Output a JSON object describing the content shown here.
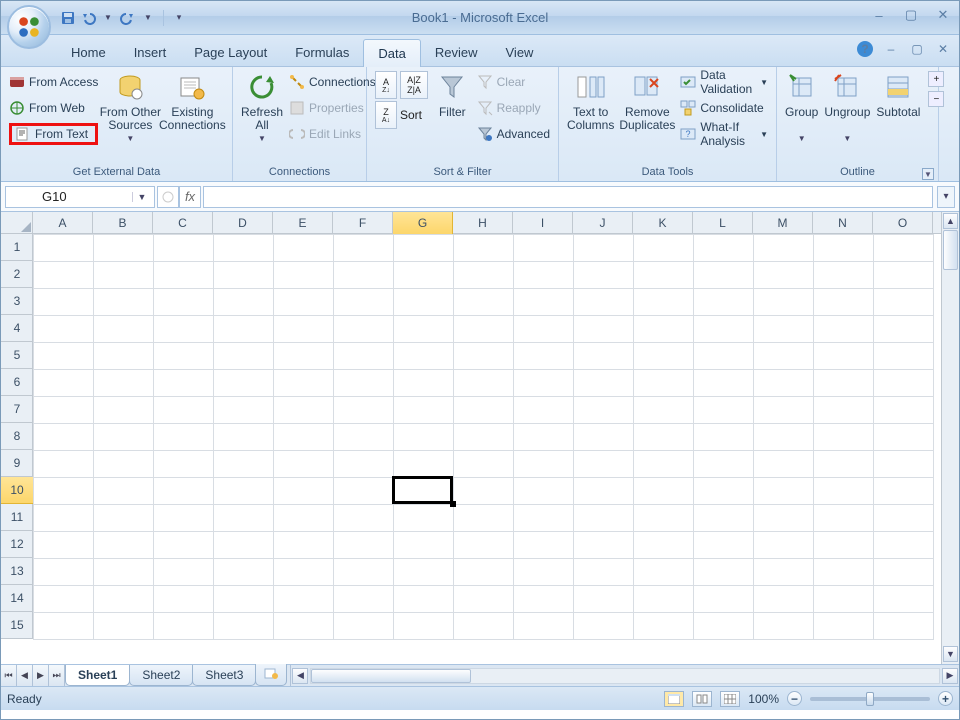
{
  "app_title": "Book1 - Microsoft Excel",
  "tabs": [
    "Home",
    "Insert",
    "Page Layout",
    "Formulas",
    "Data",
    "Review",
    "View"
  ],
  "active_tab": "Data",
  "ribbon_groups": {
    "get_external_data": {
      "label": "Get External Data",
      "from_access": "From Access",
      "from_web": "From Web",
      "from_text": "From Text",
      "from_other_sources": "From Other\nSources",
      "existing_connections": "Existing\nConnections"
    },
    "connections": {
      "label": "Connections",
      "refresh_all": "Refresh\nAll",
      "connections": "Connections",
      "properties": "Properties",
      "edit_links": "Edit Links"
    },
    "sort_filter": {
      "label": "Sort & Filter",
      "sort": "Sort",
      "filter": "Filter",
      "clear": "Clear",
      "reapply": "Reapply",
      "advanced": "Advanced"
    },
    "data_tools": {
      "label": "Data Tools",
      "text_to_columns": "Text to\nColumns",
      "remove_duplicates": "Remove\nDuplicates",
      "data_validation": "Data Validation",
      "consolidate": "Consolidate",
      "what_if_analysis": "What-If Analysis"
    },
    "outline": {
      "label": "Outline",
      "group": "Group",
      "ungroup": "Ungroup",
      "subtotal": "Subtotal"
    }
  },
  "namebox_value": "G10",
  "fx_label": "fx",
  "columns": [
    "A",
    "B",
    "C",
    "D",
    "E",
    "F",
    "G",
    "H",
    "I",
    "J",
    "K",
    "L",
    "M",
    "N",
    "O"
  ],
  "rows": [
    1,
    2,
    3,
    4,
    5,
    6,
    7,
    8,
    9,
    10,
    11,
    12,
    13,
    14,
    15
  ],
  "active_col": "G",
  "active_row": 10,
  "selected_cell": "G10",
  "sheets": [
    "Sheet1",
    "Sheet2",
    "Sheet3"
  ],
  "active_sheet": "Sheet1",
  "status_left": "Ready",
  "zoom_label": "100%"
}
